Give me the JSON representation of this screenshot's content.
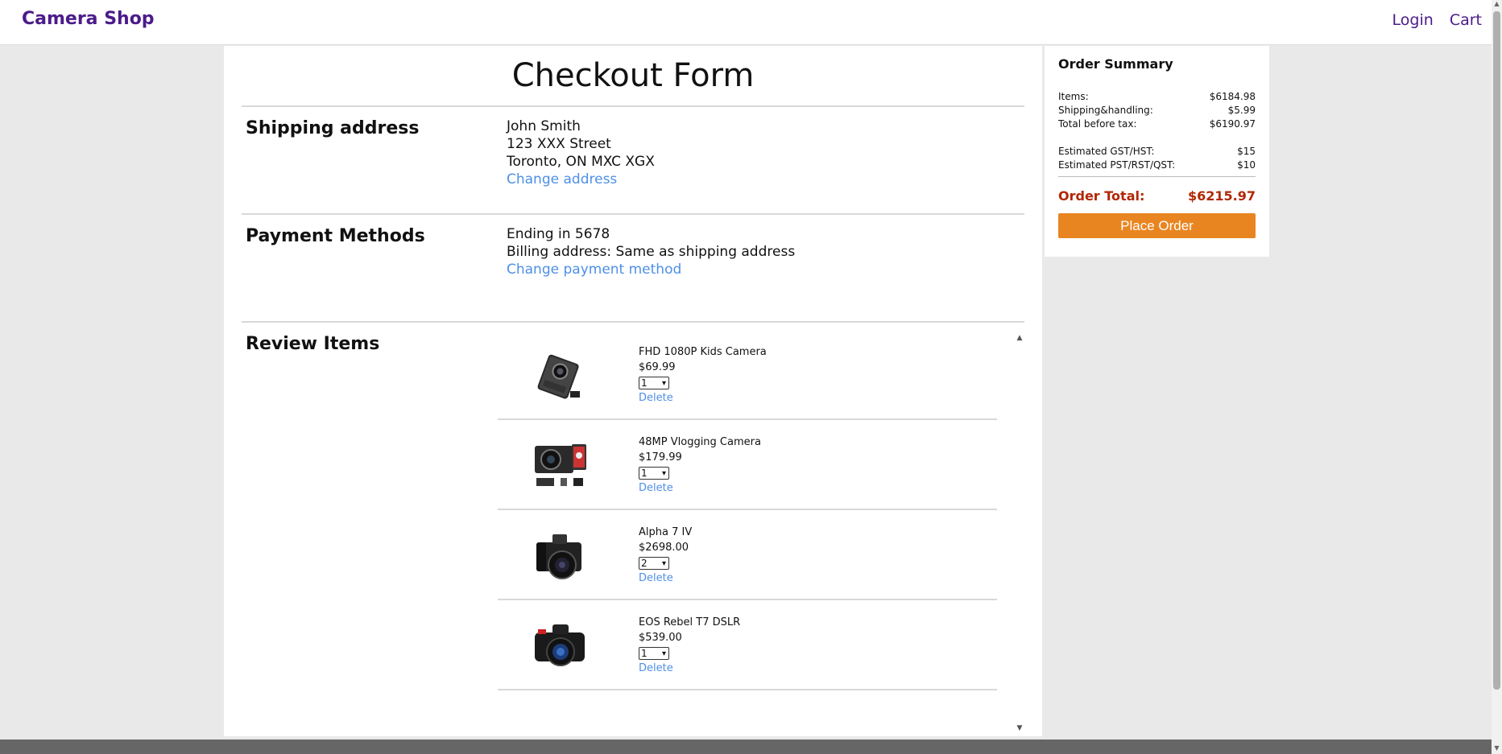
{
  "header": {
    "brand": "Camera Shop",
    "login": "Login",
    "cart": "Cart"
  },
  "page": {
    "title": "Checkout Form"
  },
  "shipping": {
    "label": "Shipping address",
    "name": "John Smith",
    "street": "123 XXX Street",
    "city": "Toronto, ON MXC XGX",
    "change": "Change address"
  },
  "payment": {
    "label": "Payment Methods",
    "card": "Ending in 5678",
    "billing": "Billing address: Same as shipping address",
    "change": "Change payment method"
  },
  "review": {
    "label": "Review Items",
    "items": [
      {
        "name": "FHD 1080P Kids Camera",
        "price": "$69.99",
        "qty": "1",
        "delete": "Delete",
        "icon": "compact-camera-icon"
      },
      {
        "name": "48MP Vlogging Camera",
        "price": "$179.99",
        "qty": "1",
        "delete": "Delete",
        "icon": "vlogging-camera-icon"
      },
      {
        "name": "Alpha 7 IV",
        "price": "$2698.00",
        "qty": "2",
        "delete": "Delete",
        "icon": "mirrorless-camera-icon"
      },
      {
        "name": "EOS Rebel T7 DSLR",
        "price": "$539.00",
        "qty": "1",
        "delete": "Delete",
        "icon": "dslr-camera-icon"
      }
    ]
  },
  "summary": {
    "title": "Order Summary",
    "items_label": "Items:",
    "items_value": "$6184.98",
    "shipping_label": "Shipping&handling:",
    "shipping_value": "$5.99",
    "before_tax_label": "Total before tax:",
    "before_tax_value": "$6190.97",
    "gst_label": "Estimated GST/HST:",
    "gst_value": "$15",
    "pst_label": "Estimated PST/RST/QST:",
    "pst_value": "$10",
    "total_label": "Order Total:",
    "total_value": "$6215.97",
    "place_order": "Place Order"
  },
  "colors": {
    "brand": "#4b1b8a",
    "link": "#4e8fe6",
    "total": "#b12704",
    "button": "#e98520"
  }
}
